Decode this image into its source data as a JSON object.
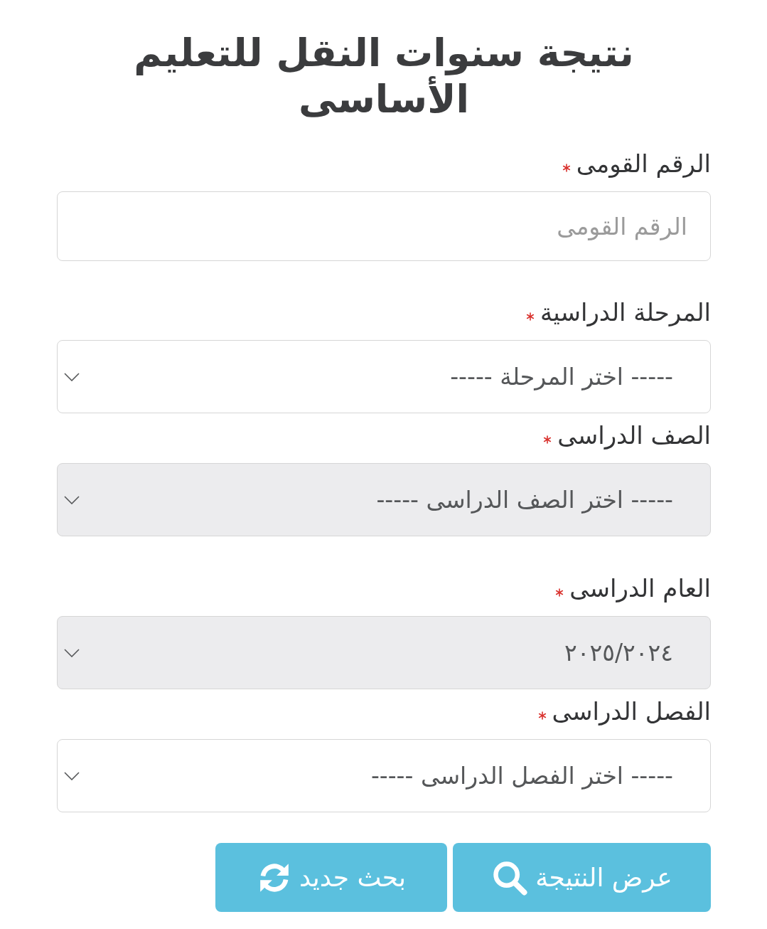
{
  "title": "نتيجة سنوات النقل للتعليم الأساسى",
  "fields": [
    {
      "kind": "input",
      "label": "الرقم القومى",
      "required": true,
      "placeholder": "الرقم القومى"
    },
    {
      "kind": "select",
      "label": "المرحلة الدراسية",
      "required": true,
      "value": "----- اختر المرحلة -----",
      "disabled": false
    },
    {
      "kind": "select",
      "label": "الصف الدراسى",
      "required": true,
      "value": "----- اختر الصف الدراسى -----",
      "disabled": true
    },
    {
      "kind": "select",
      "label": "العام الدراسى",
      "required": true,
      "value": "٢٠٢٥/٢٠٢٤",
      "disabled": true
    },
    {
      "kind": "select",
      "label": "الفصل الدراسى",
      "required": true,
      "value": "----- اختر الفصل الدراسى -----",
      "disabled": false
    }
  ],
  "buttons": [
    {
      "kind": "search",
      "label": "عرض النتيجة"
    },
    {
      "kind": "refresh",
      "label": "بحث جديد"
    }
  ]
}
